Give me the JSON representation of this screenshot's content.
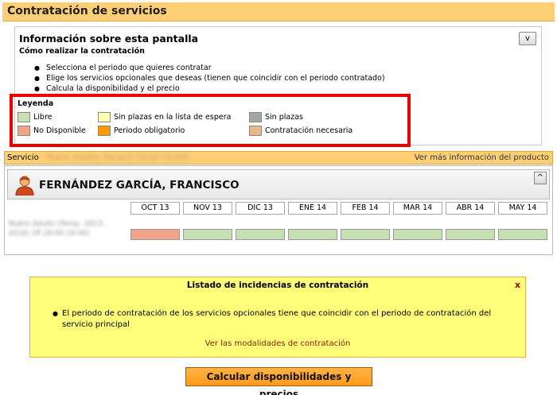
{
  "page": {
    "title": "Contratación de servicios"
  },
  "info": {
    "title": "Información sobre esta pantalla",
    "subtitle": "Cómo realizar la contratación",
    "collapse_label": "v",
    "items": [
      "Selecciona el periodo que quieres contratar",
      "Elige los servicios opcionales que deseas (tienen que coincidir con el periodo contratado)",
      "Calcula la disponibilidad y el precio"
    ]
  },
  "legend": {
    "title": "Leyenda",
    "items": [
      {
        "label": "Libre",
        "color": "#c6e0b4"
      },
      {
        "label": "Sin plazas en la lista de espera",
        "color": "#ffffb3"
      },
      {
        "label": "Sin plazas",
        "color": "#a6a6a6"
      },
      {
        "label": "No Disponible",
        "color": "#f4a28a"
      },
      {
        "label": "Periodo obligatorio",
        "color": "#ff9900"
      },
      {
        "label": "Contratación necesaria",
        "color": "#e6b98a"
      }
    ]
  },
  "service": {
    "label": "Servicio",
    "name_blurred": "Teatro Adulto, Horario 18:00-19:00h",
    "more_info_link": "Ver más información del producto"
  },
  "person": {
    "name": "FERNÁNDEZ GARCÍA, FRANCISCO",
    "collapse_label": "^",
    "row_label_blurred": "Teatro Adulto (Temp. 2013-2014) 1ff 18:00-19:00)",
    "months": [
      "OCT 13",
      "NOV 13",
      "DIC 13",
      "ENE 14",
      "FEB 14",
      "MAR 14",
      "ABR 14",
      "MAY 14"
    ],
    "month_states": [
      "No Disponible",
      "Libre",
      "Libre",
      "Libre",
      "Libre",
      "Libre",
      "Libre",
      "Libre"
    ]
  },
  "incidences": {
    "title": "Listado de incidencias de contratación",
    "close_label": "x",
    "message": "El periodo de contratación de los servicios opcionales tiene que coincidir con el periodo de contratación del servicio principal",
    "link": "Ver las modalidades de contratación"
  },
  "actions": {
    "calculate_label": "Calcular disponibilidades y precios"
  },
  "colors": {
    "accent": "#ffcf75",
    "highlight": "#ee0000",
    "incidence_bg": "#ffff7a",
    "button": "#ff9a1a"
  }
}
